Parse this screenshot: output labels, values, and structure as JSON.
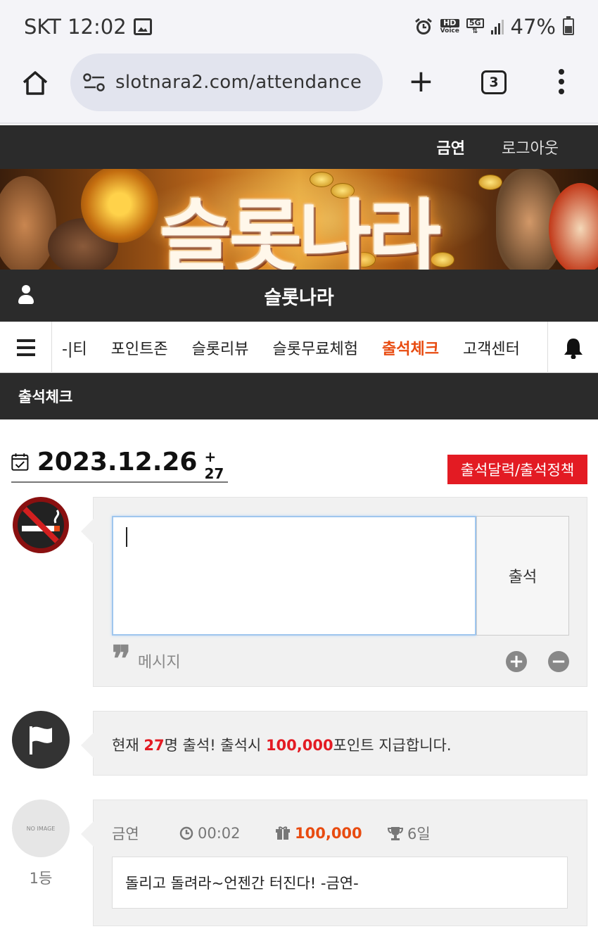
{
  "status_bar": {
    "carrier_time": "SKT 12:02",
    "hd_label": "HD",
    "voice_label": "Voice",
    "network": "5G",
    "battery": "47%"
  },
  "browser": {
    "url": "slotnara2.com/attendance",
    "tab_count": "3"
  },
  "site": {
    "username": "금연",
    "logout_label": "로그아웃",
    "banner_logo": "슬롯나라",
    "site_name": "슬롯나라",
    "nav": [
      {
        "label": "-|티"
      },
      {
        "label": "포인트존"
      },
      {
        "label": "슬롯리뷰"
      },
      {
        "label": "슬롯무료체험"
      },
      {
        "label": "출석체크"
      },
      {
        "label": "고객센터"
      }
    ],
    "page_heading": "출석체크"
  },
  "attendance": {
    "date": "2023.12.26",
    "count": "+ 27",
    "policy_button": "출석달력/출석정책",
    "textarea_value": "",
    "submit_label": "출석",
    "message_label": "메시지",
    "notice": {
      "prefix": "현재 ",
      "count": "27",
      "middle": "명 출석! 출석시 ",
      "points": "100,000",
      "suffix": "포인트 지급합니다."
    }
  },
  "entries": [
    {
      "avatar_text": "NO IMAGE",
      "rank": "1등",
      "nickname": "금연",
      "time": "00:02",
      "points": "100,000",
      "days": "6일",
      "comment": "돌리고 돌려라~언젠간 터진다! -금연-"
    }
  ],
  "colors": {
    "dark_band": "#2b2b2b",
    "accent_red": "#e31b23",
    "nav_active": "#e84b10"
  }
}
